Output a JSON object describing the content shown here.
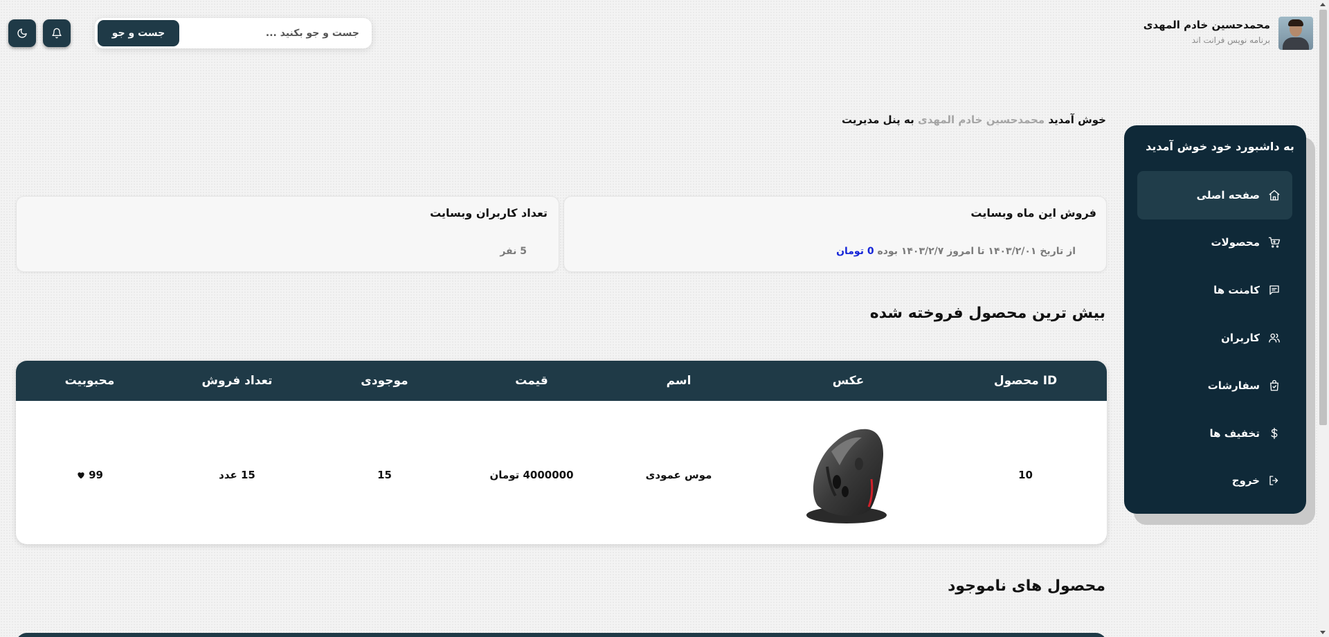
{
  "header": {
    "search_button_label": "جست و جو",
    "search_placeholder": "جست و جو بکنید ...",
    "theme_toggle_icon": "moon-icon",
    "notification_icon": "bell-icon"
  },
  "profile": {
    "name": "محمدحسین خادم المهدی",
    "role": "برنامه نویس فرانت اند"
  },
  "sidebar": {
    "title": "به داشبورد خود خوش آمدید",
    "items": [
      {
        "label": "صفحه اصلی",
        "icon": "home-icon",
        "active": true
      },
      {
        "label": "محصولات",
        "icon": "cart-icon",
        "active": false
      },
      {
        "label": "کامنت ها",
        "icon": "comment-icon",
        "active": false
      },
      {
        "label": "کاربران",
        "icon": "users-icon",
        "active": false
      },
      {
        "label": "سفارشات",
        "icon": "shopping-bag-icon",
        "active": false
      },
      {
        "label": "تخفیف ها",
        "icon": "dollar-icon",
        "active": false
      },
      {
        "label": "خروج",
        "icon": "logout-icon",
        "active": false
      }
    ]
  },
  "welcome": {
    "prefix": "خوش آمدید",
    "name": "محمدحسین خادم المهدی",
    "suffix": "به پنل مدیریت"
  },
  "stats": {
    "sales": {
      "title": "فروش این ماه وبسایت",
      "text": "از تاریخ ۱۴۰۳/۲/۰۱ تا امروز ۱۴۰۳/۲/۷ بوده",
      "amount": "0 تومان"
    },
    "users": {
      "title": "تعداد کاربران وبسایت",
      "value": "5 نفر"
    }
  },
  "best_selling": {
    "heading": "بیش ترین محصول فروخته شده",
    "columns": [
      "ID محصول",
      "عکس",
      "اسم",
      "قیمت",
      "موجودی",
      "تعداد فروش",
      "محبوبیت"
    ],
    "row": {
      "id": "10",
      "image": "vertical-mouse-image",
      "name": "موس عمودی",
      "price": "4000000 تومان",
      "stock": "15",
      "sales": "15 عدد",
      "popularity": "99",
      "popularity_icon": "heart-icon"
    }
  },
  "out_of_stock": {
    "heading": "محصول های ناموجود"
  },
  "colors": {
    "primary": "#1f3a47",
    "sidebar": "#0f2938",
    "money": "#1626d8",
    "muted": "#a5a5a5"
  }
}
